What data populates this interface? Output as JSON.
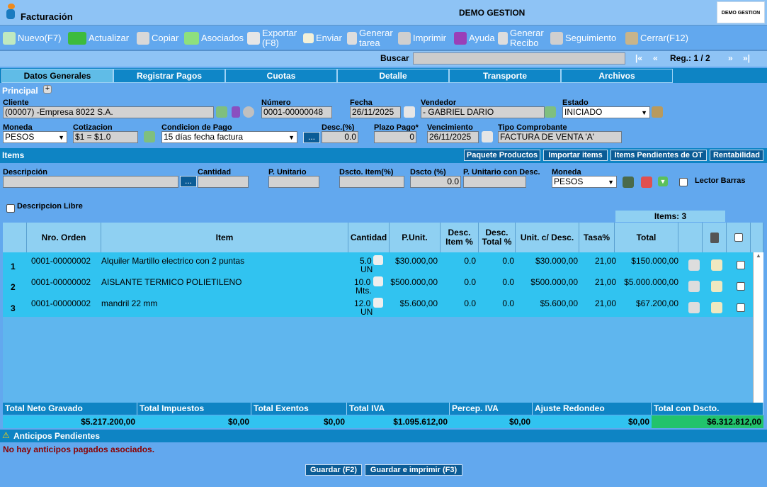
{
  "header": {
    "title": "Facturación",
    "company": "DEMO GESTION",
    "logo_text": "DEMO GESTION"
  },
  "toolbar": [
    {
      "label": "Nuevo(F7)"
    },
    {
      "label": "Actualizar"
    },
    {
      "label": "Copiar"
    },
    {
      "label": "Asociados"
    },
    {
      "label": "Exportar (F8)"
    },
    {
      "label": "Enviar"
    },
    {
      "label": "Generar tarea"
    },
    {
      "label": "Imprimir"
    },
    {
      "label": "Ayuda"
    },
    {
      "label": "Generar Recibo"
    },
    {
      "label": "Seguimiento"
    },
    {
      "label": "Cerrar(F12)"
    }
  ],
  "search": {
    "label": "Buscar",
    "value": ""
  },
  "pager": {
    "first": "|«",
    "prev": "«",
    "reg": "Reg.: 1 / 2",
    "next": "»",
    "last": "»|"
  },
  "tabs": [
    "Datos Generales",
    "Registrar Pagos",
    "Cuotas",
    "Detalle",
    "Transporte",
    "Archivos"
  ],
  "principal": {
    "title": "Principal",
    "cliente_label": "Cliente",
    "cliente": "(00007) -Empresa 8022 S.A.",
    "numero_label": "Número",
    "numero": "0001-00000048",
    "fecha_label": "Fecha",
    "fecha": "26/11/2025",
    "vendedor_label": "Vendedor",
    "vendedor": "- GABRIEL DARIO",
    "estado_label": "Estado",
    "estado": "INICIADO",
    "moneda_label": "Moneda",
    "moneda": "PESOS",
    "cotizacion_label": "Cotizacion",
    "cotizacion": "$1 = $1.0",
    "condicion_label": "Condicion de Pago",
    "condicion": "15 días fecha factura",
    "desc_label": "Desc.(%)",
    "desc": "0.0",
    "plazo_label": "Plazo Pago*",
    "plazo": "0",
    "venc_label": "Vencimiento",
    "venc": "26/11/2025",
    "tipo_label": "Tipo Comprobante",
    "tipo": "FACTURA DE VENTA 'A'"
  },
  "items_section": {
    "title": "Items",
    "buttons": [
      "Paquete Productos",
      "Importar items",
      "Items Pendientes de OT",
      "Rentabilidad"
    ],
    "descripcion_label": "Descripción",
    "cantidad_label": "Cantidad",
    "punit_label": "P. Unitario",
    "dscto_item_label": "Dscto. Item(%)",
    "dscto_label": "Dscto (%)",
    "dscto": "0.0",
    "punit_desc_label": "P. Unitario con Desc.",
    "moneda_label": "Moneda",
    "moneda": "PESOS",
    "lector_label": "Lector Barras",
    "desc_libre_label": "Descripcion Libre",
    "count_label": "Items: 3"
  },
  "grid": {
    "headers": [
      "Nro. Orden",
      "Item",
      "Cantidad",
      "P.Unit.",
      "Desc. Item %",
      "Desc. Total %",
      "Unit. c/ Desc.",
      "Tasa%",
      "Total"
    ],
    "rows": [
      {
        "n": "1",
        "orden": "0001-00000002",
        "item": "Alquiler Martillo electrico con 2 puntas",
        "cant": "5.0",
        "unidad": "UN",
        "punit": "$30.000,00",
        "desc_item": "0.0",
        "desc_total": "0.0",
        "unit_desc": "$30.000,00",
        "tasa": "21,00",
        "total": "$150.000,00"
      },
      {
        "n": "2",
        "orden": "0001-00000002",
        "item": "AISLANTE TERMICO POLIETILENO",
        "cant": "10.0",
        "unidad": "Mts.",
        "punit": "$500.000,00",
        "desc_item": "0.0",
        "desc_total": "0.0",
        "unit_desc": "$500.000,00",
        "tasa": "21,00",
        "total": "$5.000.000,00"
      },
      {
        "n": "3",
        "orden": "0001-00000002",
        "item": "mandril 22 mm",
        "cant": "12.0",
        "unidad": "UN",
        "punit": "$5.600,00",
        "desc_item": "0.0",
        "desc_total": "0.0",
        "unit_desc": "$5.600,00",
        "tasa": "21,00",
        "total": "$67.200,00"
      }
    ]
  },
  "totals": {
    "headers": [
      "Total Neto Gravado",
      "Total Impuestos",
      "Total Exentos",
      "Total IVA",
      "Percep. IVA",
      "Ajuste Redondeo",
      "Total con Dscto."
    ],
    "values": [
      "$5.217.200,00",
      "$0,00",
      "$0,00",
      "$1.095.612,00",
      "$0,00",
      "$0,00",
      "$6.312.812,00"
    ]
  },
  "anticipos": {
    "title": "Anticipos Pendientes",
    "message": "No hay anticipos pagados asociados."
  },
  "footer": {
    "save": "Guardar (F2)",
    "save_print": "Guardar e imprimir (F3)"
  },
  "colors": {
    "background": "#62a8ee",
    "tab_bar": "#0e84c4",
    "grid_row": "#31c3f0",
    "total_highlight": "#22c36c"
  }
}
